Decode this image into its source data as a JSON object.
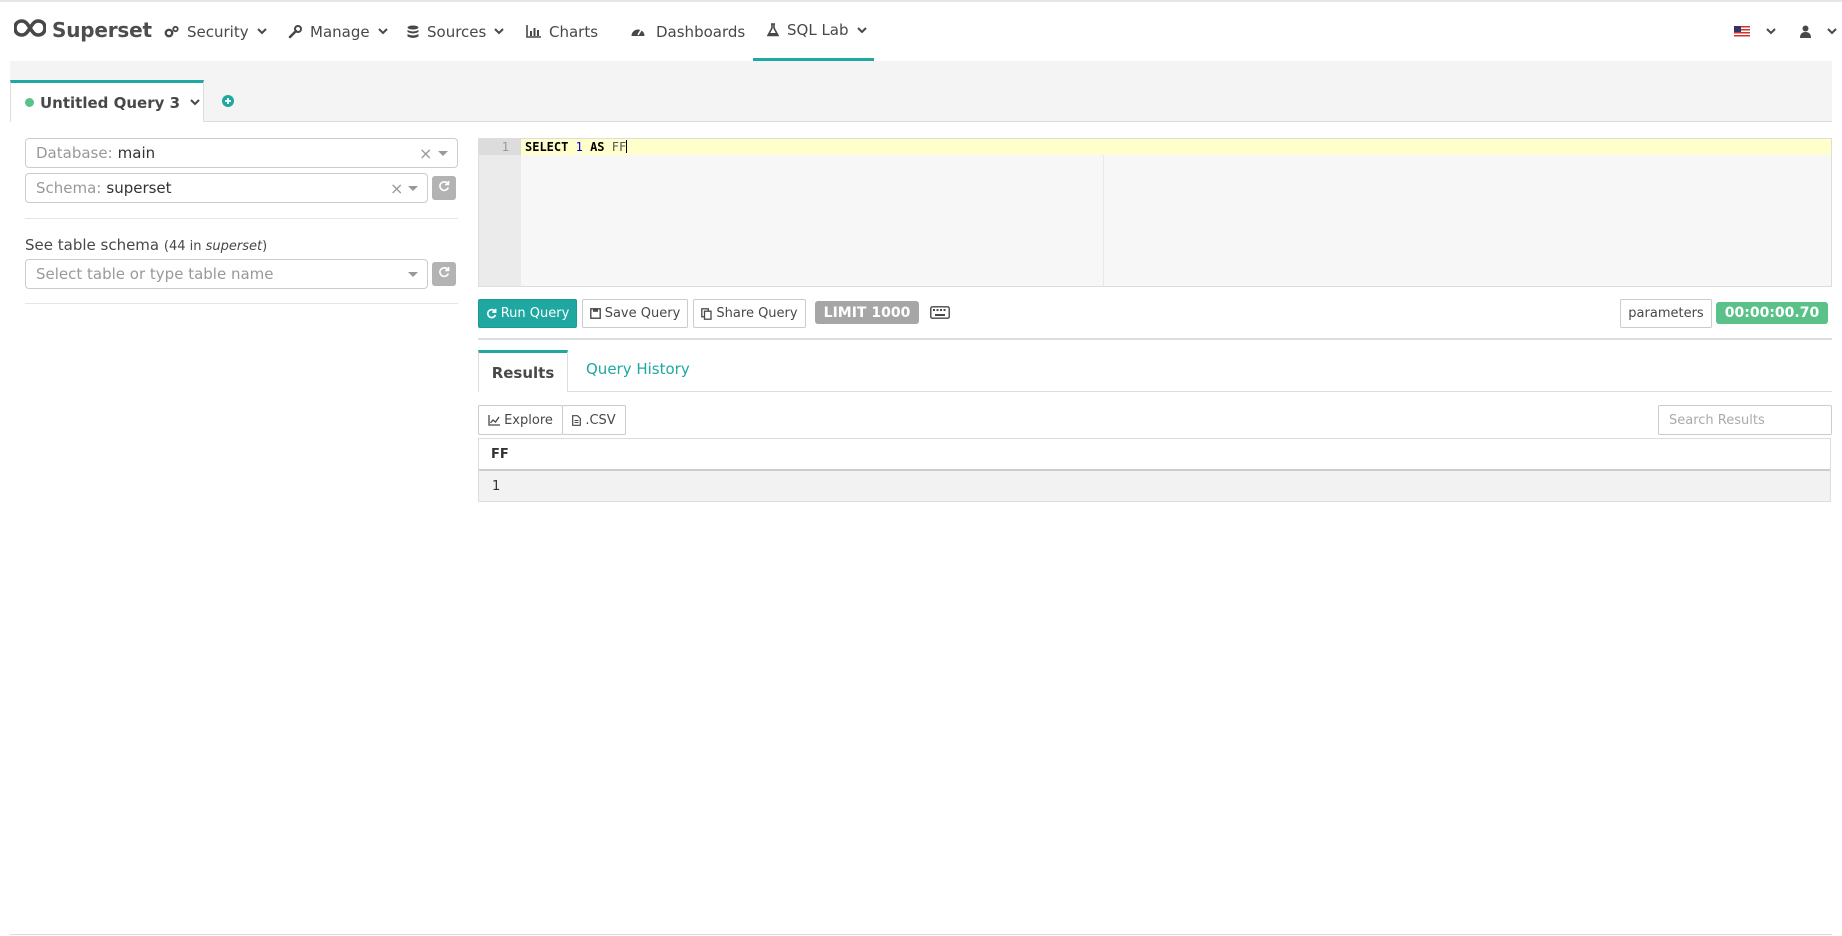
{
  "brand": {
    "name": "Superset"
  },
  "nav": {
    "security": "Security",
    "manage": "Manage",
    "sources": "Sources",
    "charts": "Charts",
    "dashboards": "Dashboards",
    "sqllab": "SQL Lab"
  },
  "query_tab": {
    "title": "Untitled Query 3",
    "status_color": "#5ac189"
  },
  "left_panel": {
    "database_label": "Database:",
    "database_value": "main",
    "schema_label": "Schema:",
    "schema_value": "superset",
    "table_schema_title": "See table schema",
    "table_count_prefix": "(44 in ",
    "table_count_schema": "superset",
    "table_count_suffix": ")",
    "table_placeholder": "Select table or type table name"
  },
  "editor": {
    "line_number": "1",
    "kw_select": "SELECT",
    "num": "1",
    "kw_as": "AS",
    "ident": "FF"
  },
  "toolbar": {
    "run": "Run Query",
    "save": "Save Query",
    "share": "Share Query",
    "limit": "LIMIT 1000",
    "parameters": "parameters",
    "timer": "00:00:00.70"
  },
  "results": {
    "tab_results": "Results",
    "tab_history": "Query History",
    "explore": "Explore",
    "csv": ".CSV",
    "search_placeholder": "Search Results",
    "columns": [
      "FF"
    ],
    "rows": [
      [
        "1"
      ]
    ]
  },
  "colors": {
    "accent": "#1fa8a1",
    "success": "#5ac189",
    "muted_badge": "#a6a6a6"
  }
}
